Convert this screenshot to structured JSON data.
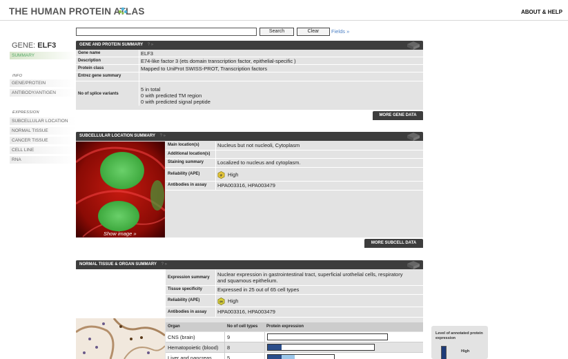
{
  "header": {
    "logo_text": "THE HUMAN PROTEIN ATLAS",
    "about": "ABOUT & HELP"
  },
  "search": {
    "value": "",
    "search_label": "Search",
    "clear_label": "Clear",
    "fields_label": "Fields »"
  },
  "nav": {
    "gene_prefix": "GENE:",
    "gene_name": "ELF3",
    "summary": "SUMMARY",
    "info_head": "INFO",
    "info_items": [
      "GENE/PROTEIN",
      "ANTIBODY/ANTIGEN"
    ],
    "expression_head": "EXPRESSION",
    "expression_items": [
      "SUBCELLULAR LOCATION",
      "NORMAL TISSUE",
      "CANCER TISSUE",
      "CELL LINE",
      "RNA"
    ]
  },
  "gene_summary": {
    "title": "GENE AND PROTEIN SUMMARY",
    "help": "? »",
    "rows": [
      {
        "label": "Gene name",
        "value": "ELF3"
      },
      {
        "label": "Description",
        "value": "E74-like factor 3 (ets domain transcription factor, epithelial-specific )"
      },
      {
        "label": "Protein class",
        "value": "Mapped to UniProt SWISS-PROT, Transcription factors"
      },
      {
        "label": "Entrez gene summary",
        "value": ""
      },
      {
        "label": "No of splice variants",
        "value_lines": [
          "5 in total",
          "0 with predicted TM region",
          "0 with predicted signal peptide"
        ]
      }
    ],
    "more_label": "MORE GENE DATA"
  },
  "subcell": {
    "title": "SUBCELLULAR LOCATION SUMMARY",
    "help": "? »",
    "rows": [
      {
        "label": "Main location(s)",
        "value": "Nucleus but not nucleoli, Cytoplasm"
      },
      {
        "label": "Additional location(s)",
        "value": ""
      },
      {
        "label": "Staining summary",
        "value": "Localized to nucleus and cytoplasm."
      },
      {
        "label": "Reliability (APE)",
        "value": "High",
        "badge": "IF"
      },
      {
        "label": "Antibodies in assay",
        "value": "HPA003316, HPA003479"
      }
    ],
    "show_image": "Show image »",
    "more_label": "MORE SUBCELL DATA",
    "badge_color": "#e8c83a"
  },
  "tissue": {
    "title": "NORMAL TISSUE & ORGAN SUMMARY",
    "help": "? »",
    "rows": [
      {
        "label": "Expression summary",
        "value_lines": [
          "Nuclear expression in gastrointestinal tract, superficial urothelial cells, respiratory",
          "and squamous epithelium."
        ]
      },
      {
        "label": "Tissue specificity",
        "value": "Expressed in 25 out of 65 cell types"
      },
      {
        "label": "Reliability (APE)",
        "value": "High",
        "badge": "IH"
      },
      {
        "label": "Antibodies in assay",
        "value": "HPA003316, HPA003479"
      }
    ],
    "table_headers": [
      "Organ",
      "No of cell types",
      "Protein expression"
    ],
    "organs": [
      {
        "organ": "CNS (brain)",
        "cell_types": "9",
        "high": 0,
        "light": 0
      },
      {
        "organ": "Hematopoietic (blood)",
        "cell_types": "8",
        "high": 0.13,
        "light": 0
      },
      {
        "organ": "Liver and pancreas",
        "cell_types": "5",
        "high": 0.2,
        "light": 0.2
      }
    ],
    "legend_title": "Level of annotated protein expression",
    "legend_high": "High",
    "bar_color": "#2a4d8a",
    "bar_light_color": "#9cc7ea"
  }
}
